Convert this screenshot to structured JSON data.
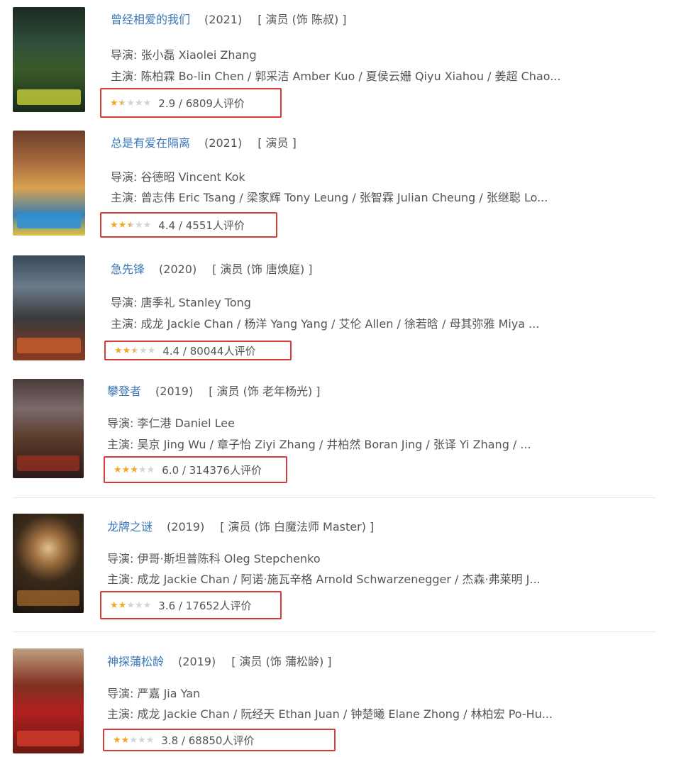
{
  "labels": {
    "director": "导演:",
    "cast": "主演:"
  },
  "colors": {
    "title_link": "#3a77b8",
    "highlight_border": "#d93a3a",
    "star_on": "#f5a623",
    "star_off": "#d4d4d4"
  },
  "movies": [
    {
      "title": "曾经相爱的我们",
      "year": "(2021)",
      "role": "[ 演员 (饰 陈叔) ]",
      "director": "张小磊 Xiaolei Zhang",
      "cast": "陈柏霖 Bo-lin Chen / 郭采洁 Amber Kuo / 夏侯云姗 Qiyu Xiahou / 姜超 Chao...",
      "stars": 1.5,
      "rating_text": "2.9 / 6809人评价"
    },
    {
      "title": "总是有爱在隔离",
      "year": "(2021)",
      "role": "[ 演员 ]",
      "director": "谷德昭 Vincent Kok",
      "cast": "曾志伟 Eric Tsang / 梁家辉 Tony Leung / 张智霖 Julian Cheung / 张继聪 Lo...",
      "stars": 2.5,
      "rating_text": "4.4 / 4551人评价"
    },
    {
      "title": "急先锋",
      "year": "(2020)",
      "role": "[ 演员 (饰 唐焕庭) ]",
      "director": "唐季礼 Stanley Tong",
      "cast": "成龙 Jackie Chan / 杨洋 Yang Yang / 艾伦 Allen / 徐若晗 / 母其弥雅 Miya ...",
      "stars": 2.5,
      "rating_text": "4.4 / 80044人评价"
    },
    {
      "title": "攀登者",
      "year": "(2019)",
      "role": "[ 演员 (饰 老年杨光) ]",
      "director": "李仁港 Daniel Lee",
      "cast": "吴京 Jing Wu / 章子怡 Ziyi Zhang / 井柏然 Boran Jing / 张译 Yi Zhang / ...",
      "stars": 3,
      "rating_text": "6.0 / 314376人评价"
    },
    {
      "title": "龙牌之谜",
      "year": "(2019)",
      "role": "[ 演员 (饰 白魔法师 Master) ]",
      "director": "伊哥·斯坦普陈科 Oleg Stepchenko",
      "cast": "成龙 Jackie Chan / 阿诺·施瓦辛格 Arnold Schwarzenegger / 杰森·弗莱明 J...",
      "stars": 2,
      "rating_text": "3.6 / 17652人评价"
    },
    {
      "title": "神探蒲松龄",
      "year": "(2019)",
      "role": "[ 演员 (饰 蒲松龄) ]",
      "director": "严嘉 Jia Yan",
      "cast": "成龙 Jackie Chan / 阮经天 Ethan Juan / 钟楚曦 Elane Zhong / 林柏宏 Po-Hu...",
      "stars": 2,
      "rating_text": "3.8 / 68850人评价"
    }
  ]
}
